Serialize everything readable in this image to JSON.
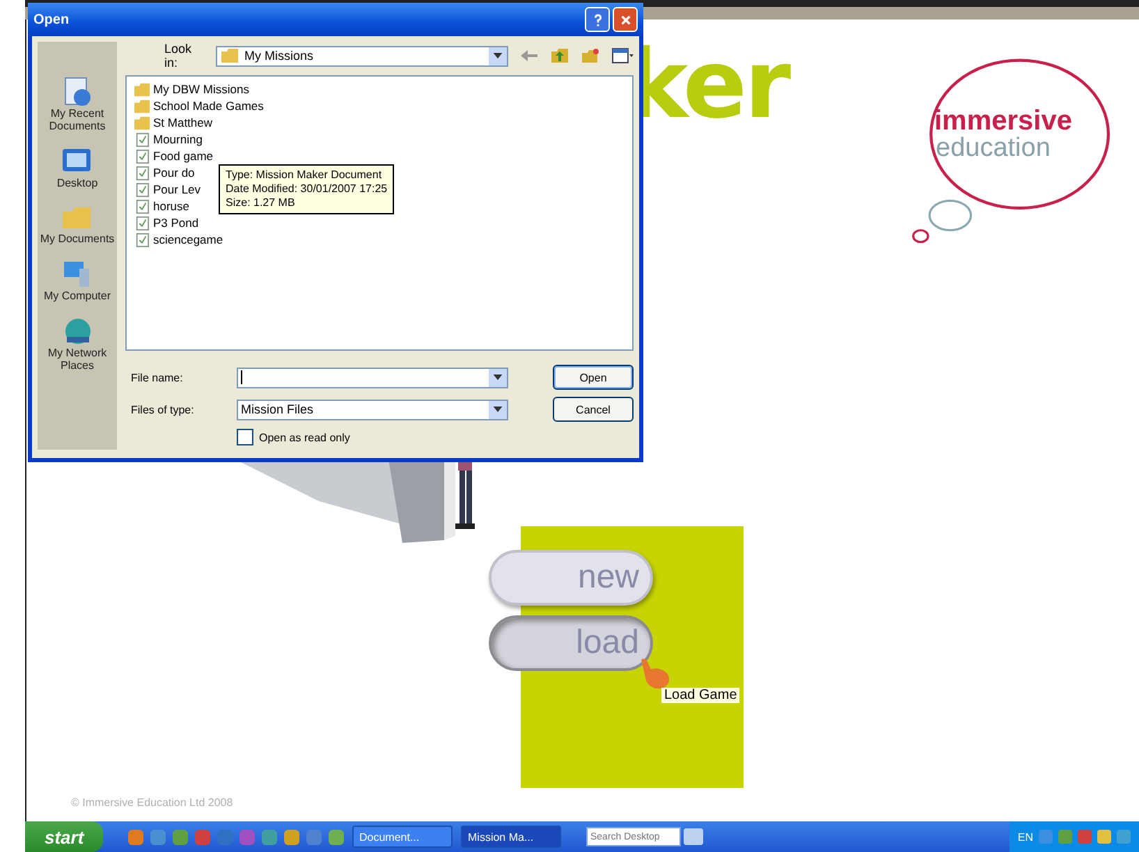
{
  "dialog": {
    "title": "Open",
    "look_in": {
      "label": "Look in:",
      "value": "My Missions"
    },
    "places": [
      {
        "label": "My Recent Documents",
        "kind": "recent"
      },
      {
        "label": "Desktop",
        "kind": "desktop"
      },
      {
        "label": "My Documents",
        "kind": "documents"
      },
      {
        "label": "My Computer",
        "kind": "computer"
      },
      {
        "label": "My Network Places",
        "kind": "network"
      }
    ],
    "files": [
      {
        "name": "My DBW Missions",
        "kind": "folder"
      },
      {
        "name": "School Made Games",
        "kind": "folder"
      },
      {
        "name": "St Matthew",
        "kind": "folder"
      },
      {
        "name": "Mourning",
        "kind": "file"
      },
      {
        "name": "Food game",
        "kind": "file"
      },
      {
        "name": "Pour do",
        "kind": "file"
      },
      {
        "name": "Pour Lev",
        "kind": "file"
      },
      {
        "name": "horuse",
        "kind": "file"
      },
      {
        "name": "P3 Pond",
        "kind": "file"
      },
      {
        "name": "sciencegame",
        "kind": "file"
      }
    ],
    "tooltip": [
      "Type: Mission Maker Document",
      "Date Modified: 30/01/2007 17:25",
      "Size: 1.27 MB"
    ],
    "file_name": {
      "label": "File name:"
    },
    "file_type": {
      "label": "Files of type:",
      "value": "Mission Files"
    },
    "read_only": {
      "label": "Open as read only",
      "checked": false
    },
    "buttons": [
      "Open",
      "Cancel"
    ]
  },
  "splash": {
    "title_fragment": "ker",
    "brand": [
      "immersive",
      "education"
    ],
    "menu": [
      {
        "label": "new",
        "hovered": false
      },
      {
        "label": "load",
        "hovered": true
      }
    ],
    "hover_tip": "Load Game",
    "copyright": "© Immersive Education Ltd 2008"
  },
  "taskbar": {
    "start": "start",
    "tasks": [
      {
        "label": "Document...",
        "selected": false
      },
      {
        "label": "Mission Ma...",
        "selected": true
      }
    ],
    "search": {
      "placeholder": "Search Desktop"
    },
    "language": "EN"
  }
}
